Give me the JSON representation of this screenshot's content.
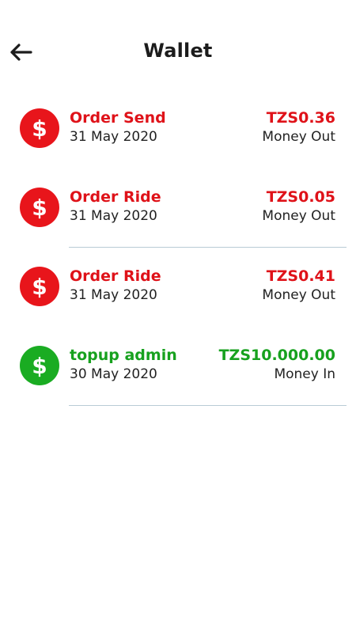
{
  "header": {
    "title": "Wallet",
    "back_icon": "arrow-left-icon"
  },
  "colors": {
    "money_out": "#df1219",
    "money_in": "#17a11e",
    "divider": "#b9cbd6"
  },
  "transactions": [
    {
      "icon": "dollar-icon",
      "title": "Order Send",
      "date": "31 May 2020",
      "amount": "TZS0.36",
      "type": "Money Out",
      "direction": "out"
    },
    {
      "icon": "dollar-icon",
      "title": "Order Ride",
      "date": "31 May 2020",
      "amount": "TZS0.05",
      "type": "Money Out",
      "direction": "out"
    },
    {
      "icon": "dollar-icon",
      "title": "Order Ride",
      "date": "31 May 2020",
      "amount": "TZS0.41",
      "type": "Money Out",
      "direction": "out"
    },
    {
      "icon": "dollar-icon",
      "title": "topup admin",
      "date": "30 May 2020",
      "amount": "TZS10.000.00",
      "type": "Money In",
      "direction": "in"
    }
  ]
}
